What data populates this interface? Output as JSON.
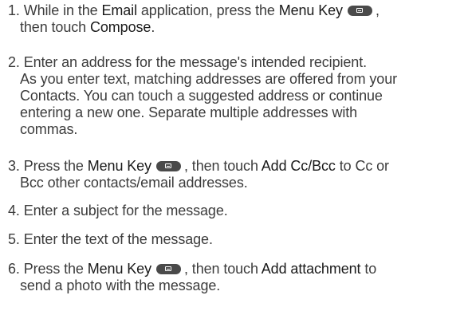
{
  "steps": [
    {
      "line1": {
        "a": "1. While in the ",
        "b": "Email",
        "c": " application, press the ",
        "d": "Menu Key",
        "e": ","
      },
      "line2": {
        "a": "then touch ",
        "b": "Compose",
        "c": "."
      }
    },
    {
      "lines": [
        "2. Enter an address for the message's intended recipient.",
        "As you enter text, matching addresses are offered from your",
        "Contacts. You can touch a suggested address or continue",
        "entering a new one. Separate multiple addresses with",
        "commas."
      ]
    },
    {
      "line1": {
        "a": "3. Press the ",
        "b": "Menu Key",
        "c": ", then touch ",
        "d": "Add Cc/Bcc",
        "e": " to Cc or"
      },
      "line2": "Bcc other contacts/email addresses."
    },
    {
      "text": "4. Enter a subject for the message."
    },
    {
      "text": "5. Enter the text of the message."
    },
    {
      "line1": {
        "a": "6. Press the ",
        "b": "Menu Key",
        "c": ", then touch ",
        "d": "Add attachment",
        "e": " to"
      },
      "line2": "send a photo with the message."
    }
  ],
  "icons": {
    "menu_key": "menu-key-icon"
  },
  "colors": {
    "body_text": "#3c3c3c",
    "ui_term": "#1a1a1a",
    "key_icon": "#4a4a4a"
  }
}
